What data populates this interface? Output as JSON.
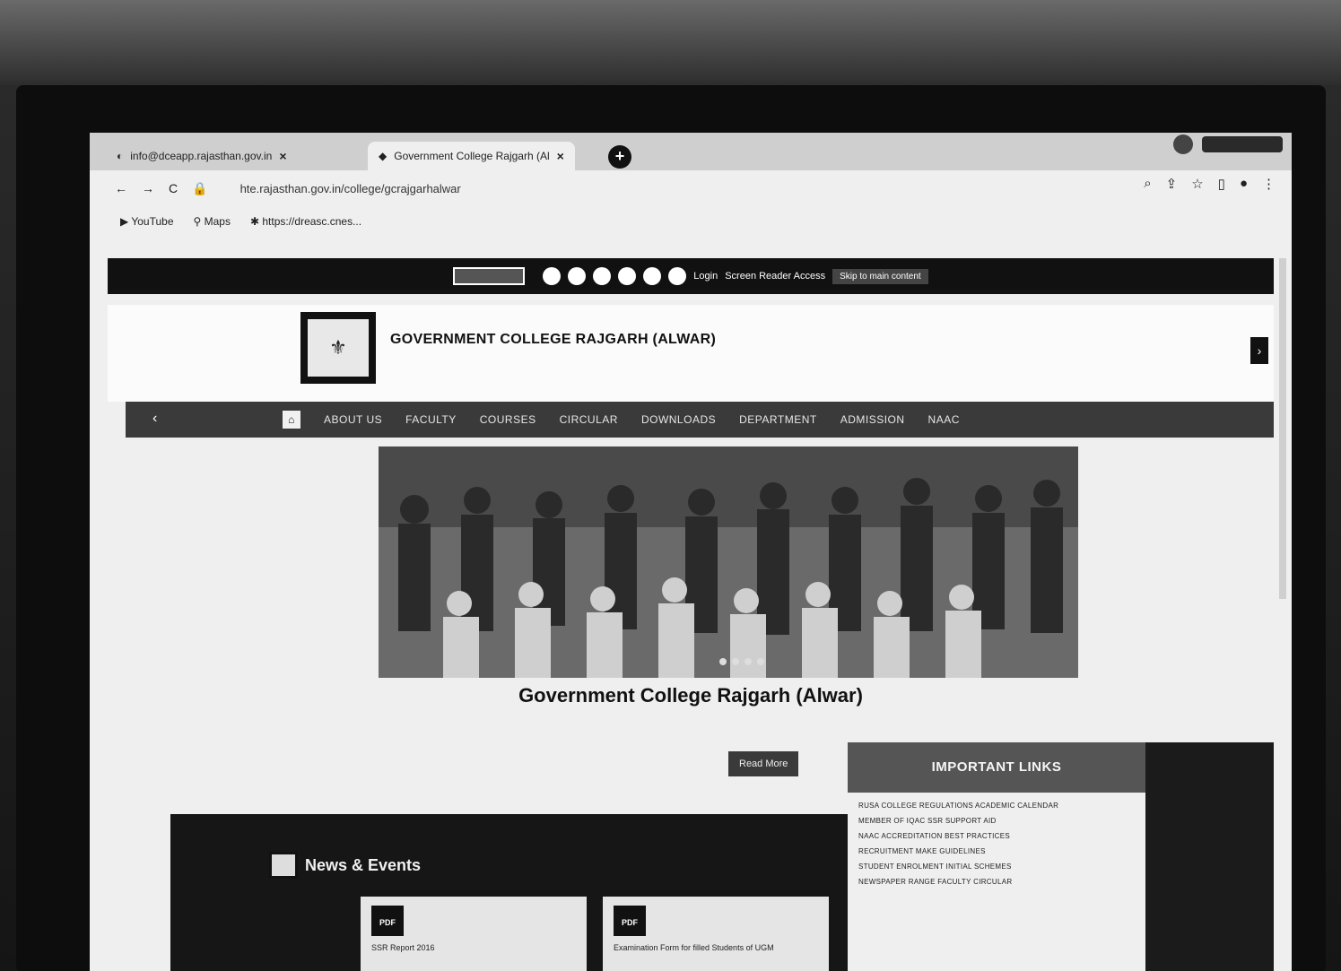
{
  "tabs": [
    {
      "title": "info@dceapp.rajasthan.gov.in",
      "close": "×"
    },
    {
      "title": "Government College Rajgarh (Al",
      "close": "×"
    }
  ],
  "new_tab": "+",
  "address": {
    "url": "hte.rajasthan.gov.in/college/gcrajgarhalwar"
  },
  "bookmarks": [
    {
      "icon": "youtube-icon",
      "label": "YouTube"
    },
    {
      "icon": "maps-icon",
      "label": "Maps"
    },
    {
      "icon": "link-icon",
      "label": "https://dreasc.cnes..."
    }
  ],
  "utility": {
    "login": "Login",
    "screen_reader": "Screen Reader Access",
    "skip": "Skip to main content"
  },
  "header": {
    "college_name": "GOVERNMENT COLLEGE RAJGARH (ALWAR)"
  },
  "nav": {
    "items": [
      "ABOUT US",
      "FACULTY",
      "COURSES",
      "CIRCULAR",
      "DOWNLOADS",
      "DEPARTMENT",
      "ADMISSION",
      "NAAC"
    ]
  },
  "main": {
    "title": "Government College Rajgarh (Alwar)",
    "read_more": "Read More"
  },
  "news": {
    "title": "News & Events",
    "cards": [
      {
        "badge": "PDF",
        "text": "SSR Report 2016"
      },
      {
        "badge": "PDF",
        "text": "Examination Form for filled Students of UGM"
      }
    ]
  },
  "important_links": {
    "title": "IMPORTANT LINKS",
    "items": [
      "RUSA COLLEGE REGULATIONS ACADEMIC CALENDAR",
      "MEMBER OF IQAC SSR SUPPORT AID",
      "NAAC ACCREDITATION BEST PRACTICES",
      "RECRUITMENT MAKE GUIDELINES",
      "STUDENT ENROLMENT INITIAL SCHEMES",
      "NEWSPAPER RANGE FACULTY CIRCULAR"
    ]
  },
  "colors": {
    "screen_bg": "#efefef",
    "nav_bg": "#3a3a3a",
    "dark_panel": "#161616"
  }
}
